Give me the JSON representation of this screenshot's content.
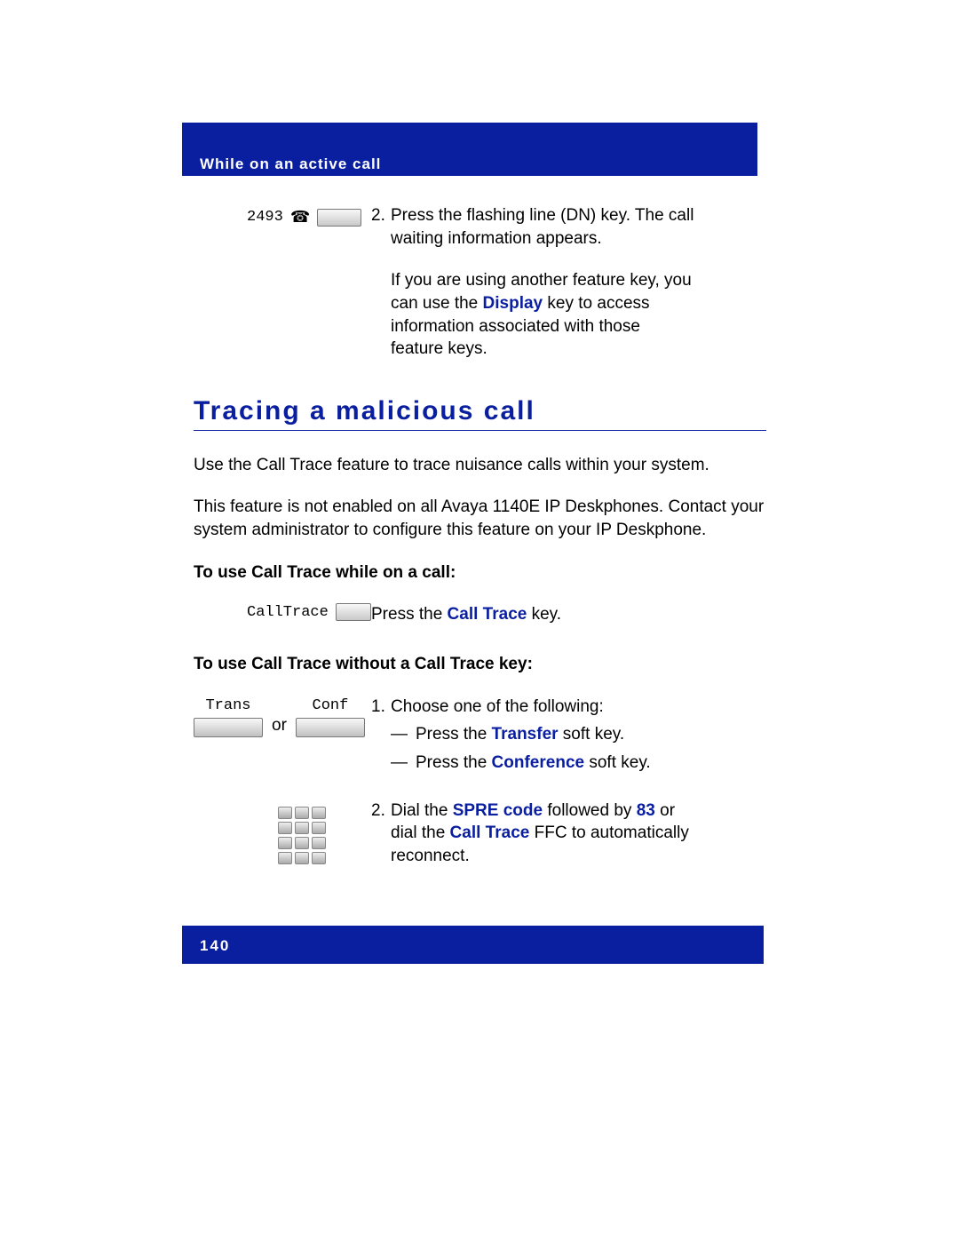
{
  "header": {
    "title": "While on an active call"
  },
  "footer": {
    "page_number": "140"
  },
  "line_key": {
    "dn": "2493"
  },
  "step2": {
    "num": "2.",
    "line1": "Press the flashing line (DN) key. The call",
    "line2": "waiting information appears.",
    "line3": "If you are using another feature key, you",
    "line4a": "can use the ",
    "line4_key": "Display",
    "line4b": " key to access",
    "line5": "information associated with those",
    "line6": "feature keys."
  },
  "section": {
    "title": "Tracing a malicious call"
  },
  "para1": "Use the Call Trace feature to trace nuisance calls within your system.",
  "para2": "This feature is not enabled on all Avaya 1140E IP Deskphones. Contact your system administrator to configure this feature on your IP Deskphone.",
  "sub1": "To use Call Trace while on a call:",
  "calltrace": {
    "label": "CallTrace",
    "text_a": "Press the ",
    "text_key": "Call Trace",
    "text_b": " key."
  },
  "sub2": "To use Call Trace without a Call Trace key:",
  "softkeys": {
    "trans": "Trans",
    "conf": "Conf",
    "or": "or"
  },
  "step_a": {
    "num": "1.",
    "line1": "Choose one of the following:",
    "dash": "—",
    "opt1a": "Press the ",
    "opt1_key": "Transfer",
    "opt1b": " soft key.",
    "opt2a": "Press the ",
    "opt2_key": "Conference",
    "opt2b": " soft key."
  },
  "step_b": {
    "num": "2.",
    "a": "Dial the ",
    "k1": "SPRE code",
    "b": " followed by ",
    "k2": "83",
    "c": " or",
    "line2a": "dial the ",
    "line2_key": "Call Trace",
    "line2b": " FFC to automatically",
    "line3": "reconnect."
  }
}
